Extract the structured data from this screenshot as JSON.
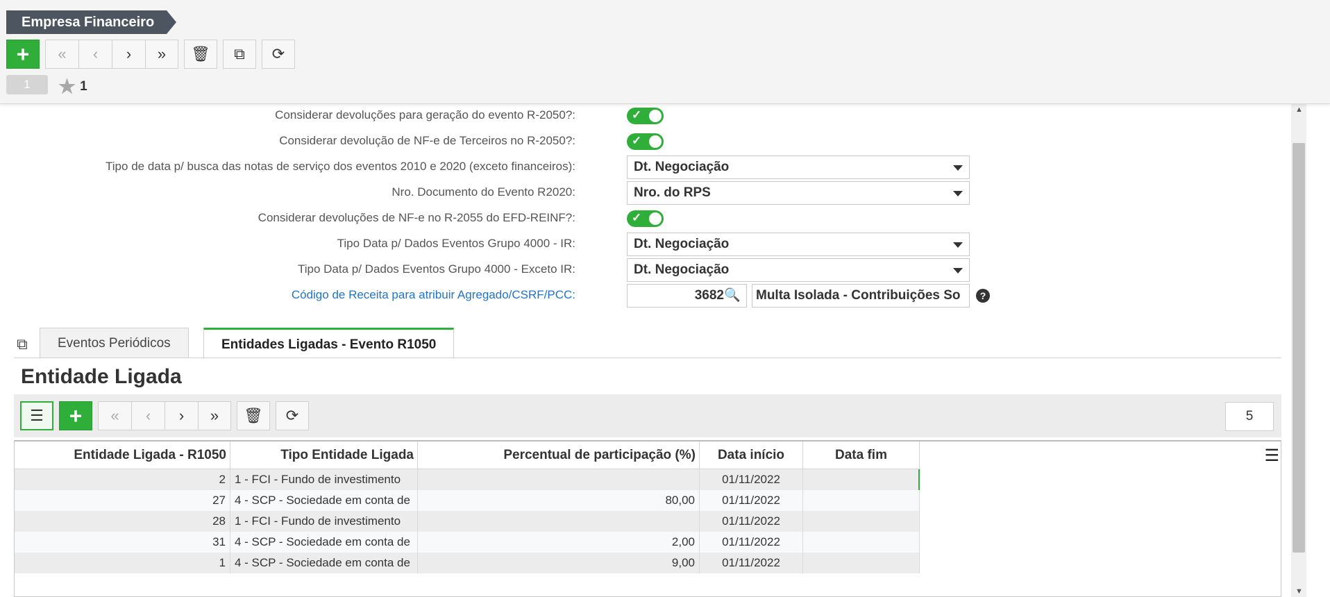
{
  "header": {
    "title": "Empresa Financeiro",
    "page_indicator": "1",
    "favorites_count": "1"
  },
  "form": {
    "rows": [
      {
        "label": "Considerar devoluções para geração do evento R-2050?:",
        "type": "toggle",
        "value": true
      },
      {
        "label": "Considerar devolução de NF-e de Terceiros no R-2050?:",
        "type": "toggle",
        "value": true
      },
      {
        "label": "Tipo de data p/ busca das notas de serviço dos eventos 2010 e 2020 (exceto financeiros):",
        "type": "select",
        "value": "Dt. Negociação"
      },
      {
        "label": "Nro. Documento do Evento R2020:",
        "type": "select",
        "value": "Nro. do RPS"
      },
      {
        "label": "Considerar devoluções de NF-e no R-2055 do EFD-REINF?:",
        "type": "toggle",
        "value": true
      },
      {
        "label": "Tipo Data p/ Dados Eventos Grupo 4000 - IR:",
        "type": "select",
        "value": "Dt. Negociação"
      },
      {
        "label": "Tipo Data p/ Dados Eventos Grupo 4000 - Exceto IR:",
        "type": "select",
        "value": "Dt. Negociação"
      }
    ],
    "receita": {
      "label": "Código de Receita para atribuir Agregado/CSRF/PCC:",
      "code": "3682",
      "description": "Multa Isolada - Contribuições So"
    }
  },
  "tabs": [
    {
      "label": "Eventos Periódicos",
      "active": false
    },
    {
      "label": "Entidades Ligadas - Evento R1050",
      "active": true
    }
  ],
  "section": {
    "title": "Entidade Ligada",
    "page_size": "5"
  },
  "grid": {
    "columns": [
      "Entidade Ligada - R1050",
      "Tipo Entidade Ligada",
      "Percentual de participação (%)",
      "Data início",
      "Data fim"
    ],
    "rows": [
      [
        "2",
        "1 - FCI - Fundo de investimento",
        "",
        "01/11/2022",
        ""
      ],
      [
        "27",
        "4 - SCP - Sociedade em conta de",
        "80,00",
        "01/11/2022",
        ""
      ],
      [
        "28",
        "1 - FCI - Fundo de investimento",
        "",
        "01/11/2022",
        ""
      ],
      [
        "31",
        "4 - SCP - Sociedade em conta de",
        "2,00",
        "01/11/2022",
        ""
      ],
      [
        "1",
        "4 - SCP - Sociedade em conta de",
        "9,00",
        "01/11/2022",
        ""
      ]
    ]
  },
  "colors": {
    "accent_green": "#2fae3a",
    "header_tag": "#4d5561",
    "link_blue": "#1f73c9"
  }
}
